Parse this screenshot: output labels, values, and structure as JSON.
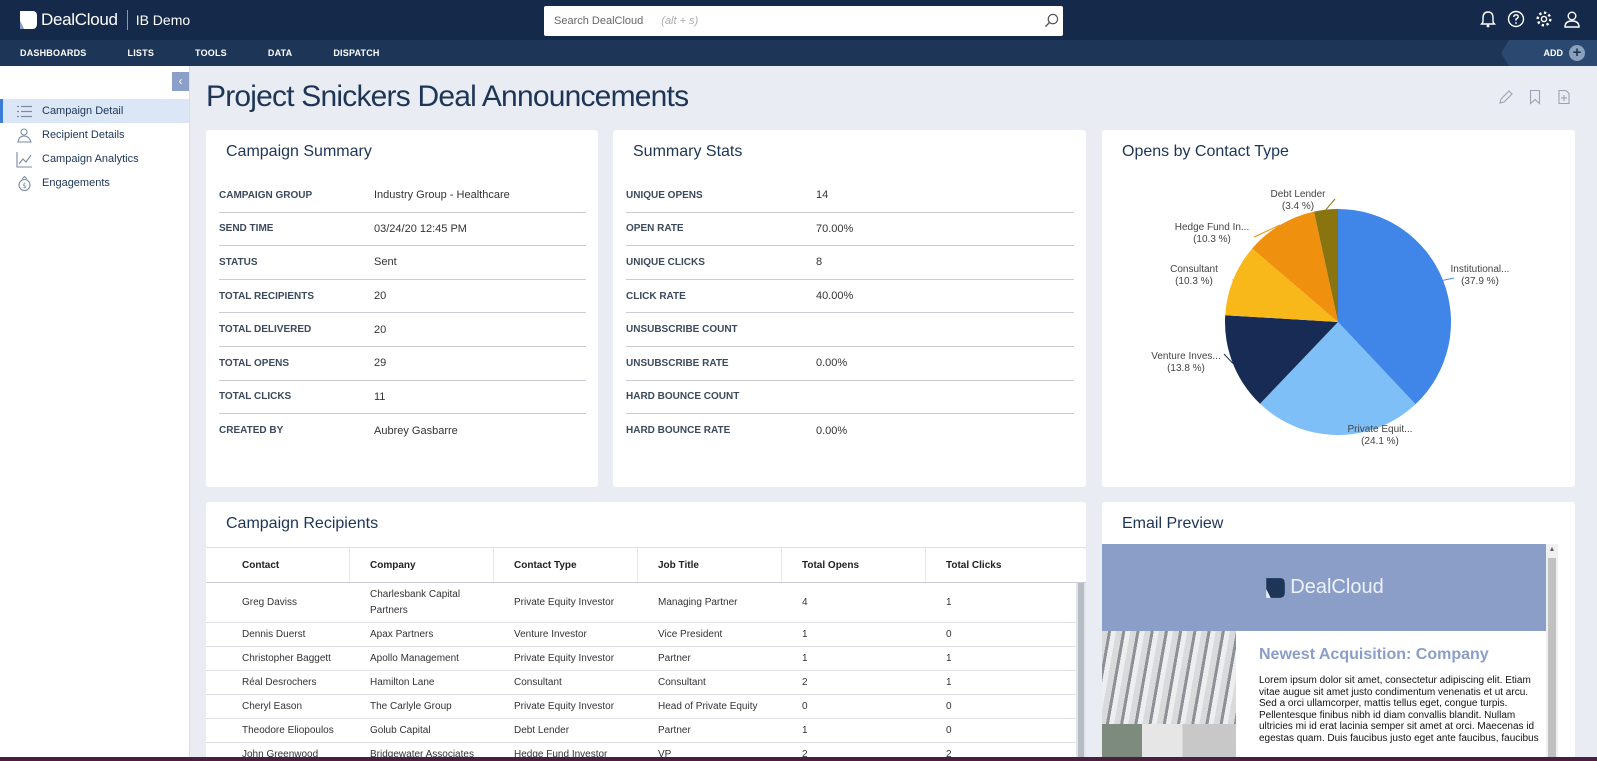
{
  "app": {
    "logo_text": "DealCloud",
    "workspace": "IB Demo"
  },
  "search": {
    "label": "Search DealCloud",
    "hint": "(alt + s)"
  },
  "nav": {
    "items": [
      "DASHBOARDS",
      "LISTS",
      "TOOLS",
      "DATA",
      "DISPATCH"
    ],
    "add_label": "ADD"
  },
  "sidebar": {
    "items": [
      {
        "label": "Campaign Detail",
        "icon": "list-icon",
        "active": true
      },
      {
        "label": "Recipient Details",
        "icon": "recipient-icon",
        "active": false
      },
      {
        "label": "Campaign Analytics",
        "icon": "line-chart-icon",
        "active": false
      },
      {
        "label": "Engagements",
        "icon": "engagement-icon",
        "active": false
      }
    ]
  },
  "page": {
    "title": "Project Snickers Deal Announcements"
  },
  "campaign_summary": {
    "title": "Campaign Summary",
    "rows": [
      {
        "key": "CAMPAIGN GROUP",
        "value": "Industry Group - Healthcare"
      },
      {
        "key": "SEND TIME",
        "value": "03/24/20 12:45 PM"
      },
      {
        "key": "STATUS",
        "value": "Sent"
      },
      {
        "key": "TOTAL RECIPIENTS",
        "value": "20"
      },
      {
        "key": "TOTAL DELIVERED",
        "value": "20"
      },
      {
        "key": "TOTAL OPENS",
        "value": "29"
      },
      {
        "key": "TOTAL CLICKS",
        "value": "11"
      },
      {
        "key": "CREATED BY",
        "value": "Aubrey Gasbarre"
      }
    ]
  },
  "summary_stats": {
    "title": "Summary Stats",
    "rows": [
      {
        "key": "UNIQUE OPENS",
        "value": "14"
      },
      {
        "key": "OPEN RATE",
        "value": "70.00%"
      },
      {
        "key": "UNIQUE CLICKS",
        "value": "8"
      },
      {
        "key": "CLICK RATE",
        "value": "40.00%"
      },
      {
        "key": "UNSUBSCRIBE COUNT",
        "value": ""
      },
      {
        "key": "UNSUBSCRIBE RATE",
        "value": "0.00%"
      },
      {
        "key": "HARD BOUNCE COUNT",
        "value": ""
      },
      {
        "key": "HARD BOUNCE RATE",
        "value": "0.00%"
      }
    ]
  },
  "opens_chart": {
    "title": "Opens by Contact Type"
  },
  "chart_data": {
    "type": "pie",
    "title": "Opens by Contact Type",
    "slices": [
      {
        "label": "Institutional...",
        "pct_label": "(37.9 %)",
        "value": 37.9,
        "color": "#3f86e8"
      },
      {
        "label": "Private Equit...",
        "pct_label": "(24.1 %)",
        "value": 24.1,
        "color": "#7fbff8"
      },
      {
        "label": "Venture Inves...",
        "pct_label": "(13.8 %)",
        "value": 13.8,
        "color": "#172b55"
      },
      {
        "label": "Consultant",
        "pct_label": "(10.3 %)",
        "value": 10.3,
        "color": "#f8b81a"
      },
      {
        "label": "Hedge Fund In...",
        "pct_label": "(10.3 %)",
        "value": 10.3,
        "color": "#f0900f"
      },
      {
        "label": "Debt Lender",
        "pct_label": "(3.4 %)",
        "value": 3.4,
        "color": "#8a7410"
      }
    ]
  },
  "recipients": {
    "title": "Campaign Recipients",
    "columns": [
      "Contact",
      "Company",
      "Contact Type",
      "Job Title",
      "Total Opens",
      "Total Clicks"
    ],
    "rows": [
      [
        "Greg Daviss",
        "Charlesbank Capital Partners",
        "Private Equity Investor",
        "Managing Partner",
        "4",
        "1"
      ],
      [
        "Dennis Duerst",
        "Apax Partners",
        "Venture Investor",
        "Vice President",
        "1",
        "0"
      ],
      [
        "Christopher Baggett",
        "Apollo Management",
        "Private Equity Investor",
        "Partner",
        "1",
        "1"
      ],
      [
        "Réal Desrochers",
        "Hamilton Lane",
        "Consultant",
        "Consultant",
        "2",
        "1"
      ],
      [
        "Cheryl Eason",
        "The Carlyle Group",
        "Private Equity Investor",
        "Head of Private Equity",
        "0",
        "0"
      ],
      [
        "Theodore Eliopoulos",
        "Golub Capital",
        "Debt Lender",
        "Partner",
        "1",
        "0"
      ],
      [
        "John Greenwood",
        "Bridgewater Associates",
        "Hedge Fund Investor",
        "VP",
        "2",
        "2"
      ]
    ]
  },
  "email_preview": {
    "title": "Email Preview",
    "logo_text": "DealCloud",
    "headline": "Newest Acquisition: Company",
    "body": "Lorem ipsum dolor sit amet, consectetur adipiscing elit. Etiam vitae augue sit amet justo condimentum venenatis et ut arcu. Sed a orci ullamcorper, mattis tellus eget, congue turpis. Pellentesque finibus nibh id diam convallis blandit. Nullam ultricies mi id erat lacinia semper sit amet at orci. Maecenas id egestas quam. Duis faucibus justo eget ante faucibus, faucibus"
  }
}
